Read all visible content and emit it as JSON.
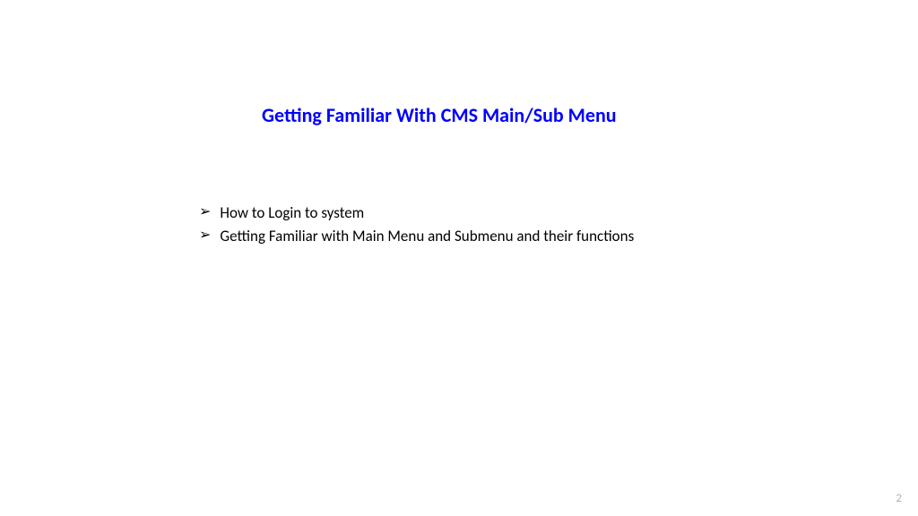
{
  "title": "Getting Familiar With CMS Main/Sub Menu",
  "bullets": [
    "How to Login to system",
    "Getting Familiar with Main Menu and Submenu and their functions"
  ],
  "bullet_symbol": "➢",
  "page_number": "2"
}
